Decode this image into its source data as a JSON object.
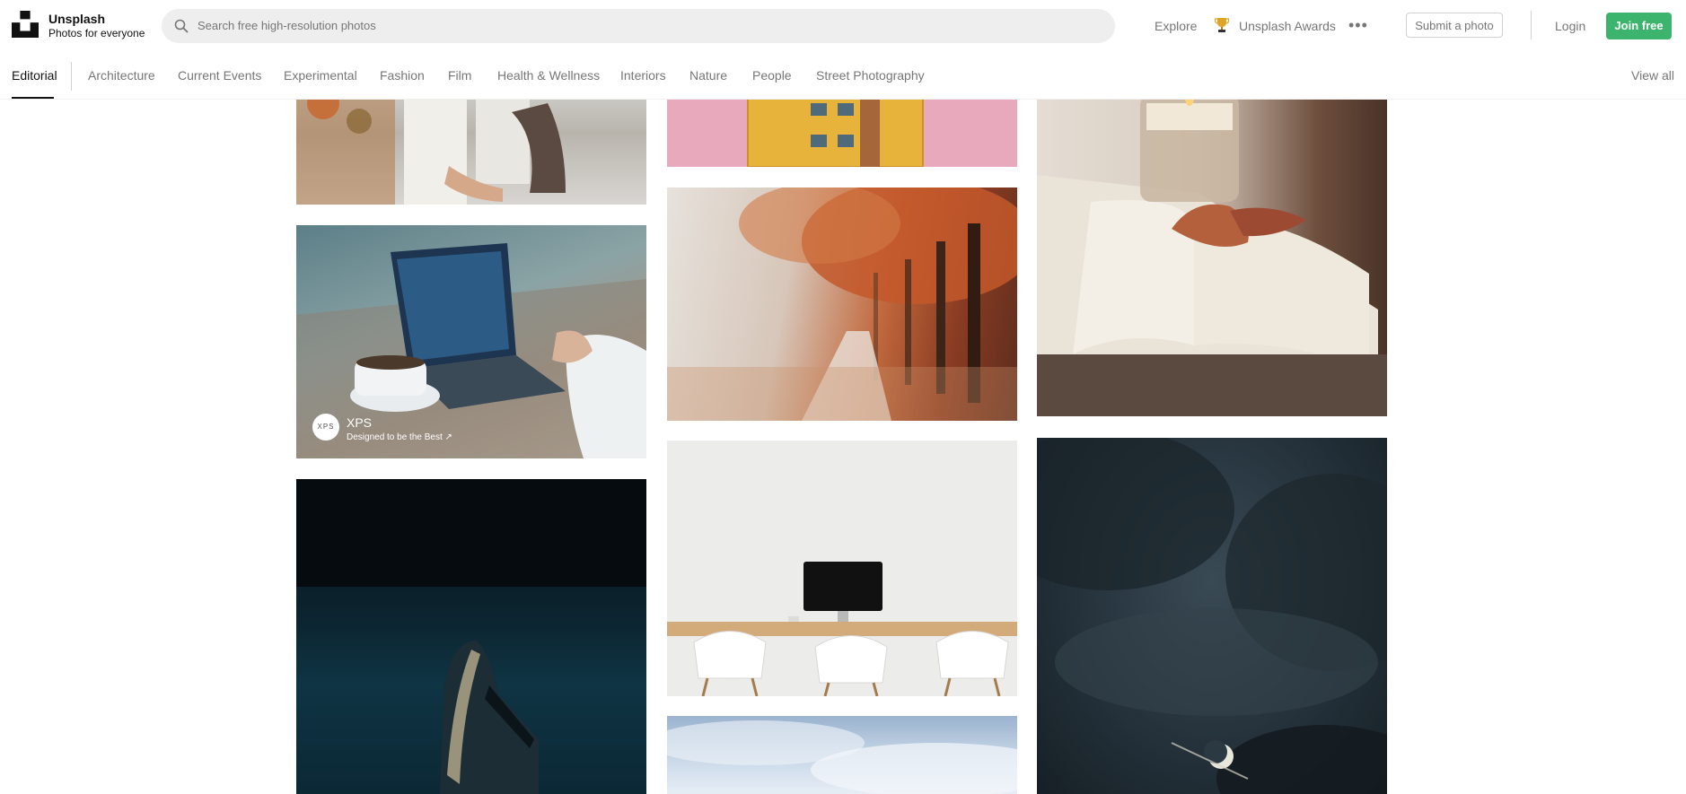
{
  "brand": {
    "name": "Unsplash",
    "tagline": "Photos for everyone"
  },
  "search": {
    "placeholder": "Search free high-resolution photos"
  },
  "nav": {
    "explore": "Explore",
    "awards": "Unsplash Awards",
    "submit": "Submit a photo",
    "login": "Login",
    "join": "Join free"
  },
  "topics": {
    "active": "Editorial",
    "items": [
      "Architecture",
      "Current Events",
      "Experimental",
      "Fashion",
      "Film",
      "Health & Wellness",
      "Interiors",
      "Nature",
      "People",
      "Street Photography"
    ],
    "view_all": "View all"
  },
  "sponsor": {
    "logo_text": "XPS",
    "name": "XPS",
    "tagline": "Designed to be the Best ↗"
  },
  "colors": {
    "accent": "#3cb46e",
    "text_muted": "#767676"
  },
  "icons": [
    "logo-icon",
    "search-icon",
    "trophy-icon",
    "more-icon"
  ]
}
